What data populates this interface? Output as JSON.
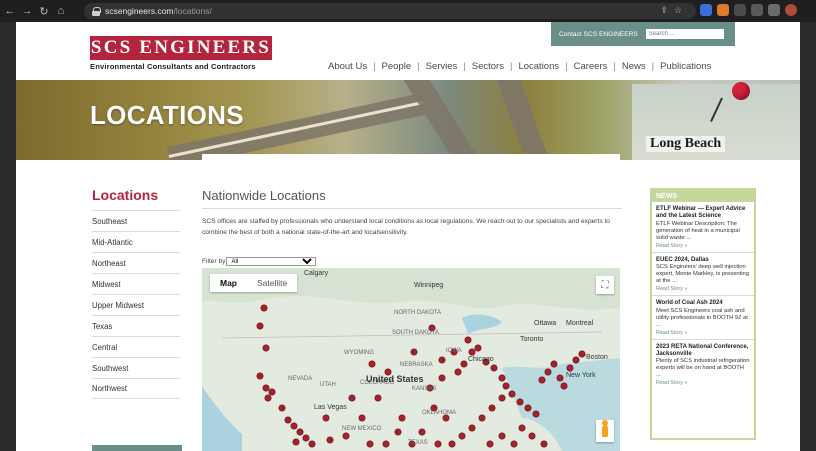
{
  "browser": {
    "url_host": "scsengineers.com",
    "url_path": "/locations/"
  },
  "header": {
    "logo_text": "SCS ENGINEERS",
    "logo_sub": "Environmental Consultants and Contractors",
    "contact": "Contact SCS ENGINEERS",
    "search_placeholder": "Search ...",
    "nav": [
      "About Us",
      "People",
      "Servies",
      "Sectors",
      "Locations",
      "Careers",
      "News",
      "Publications"
    ]
  },
  "banner": {
    "title": "LOCATIONS",
    "map_label": "Long Beach"
  },
  "sidebar": {
    "title": "Locations",
    "items": [
      "Southeast",
      "Mid-Atlantic",
      "Northeast",
      "Midwest",
      "Upper Midwest",
      "Texas",
      "Central",
      "Southwest",
      "Northwest"
    ]
  },
  "main": {
    "title": "Nationwide Locations",
    "intro": "SCS offices are staffed by professionals who understand local conditions as local regulations. We reach out to our specialists and experts to combine the best of both a national state-of-the-art and localsensitivity.",
    "filter_label": "Filter by",
    "filter_value": "All"
  },
  "map": {
    "toggle_map": "Map",
    "toggle_satellite": "Satellite",
    "country_label": "United States",
    "labels": [
      "Calgary",
      "Winnipeg",
      "Ottawa",
      "Montreal",
      "Toronto",
      "Chicago",
      "New York",
      "Boston",
      "Las Vegas",
      "NEW MEXICO",
      "TEXAS",
      "NEVADA",
      "NORTH DAKOTA",
      "SOUTH DAKOTA",
      "WYOMING",
      "NEBRASKA",
      "IOWA",
      "KANSAS",
      "OKLAHOMA",
      "COLORADO",
      "UTAH"
    ],
    "marker_color": "#a3232c"
  },
  "news": {
    "heading": "NEWS",
    "items": [
      {
        "title": "ETLF Webinar — Expert Advice and the Latest Science",
        "desc": "ETLF Webinar Description: The generation of heat in a municipal solid waste ...",
        "more": "Read Story »"
      },
      {
        "title": "EUEC 2024, Dallas",
        "desc": "SCS Engineers' deep well injection expert, Monte Markley, is presenting at the ...",
        "more": "Read Story »"
      },
      {
        "title": "World of Coal Ash 2024",
        "desc": "Meet SCS Engineers coal ash and utility professionals in BOOTH 92 at ...",
        "more": "Read Story »"
      },
      {
        "title": "2023 RETA National Conference, Jacksonville",
        "desc": "Plenty of SCS industrial refrigeration experts will be on hand at BOOTH ...",
        "more": "Read Story »"
      }
    ]
  },
  "colors": {
    "brand_red": "#b3253d",
    "teal": "#6a8e88",
    "news_green": "#c6d79b"
  }
}
